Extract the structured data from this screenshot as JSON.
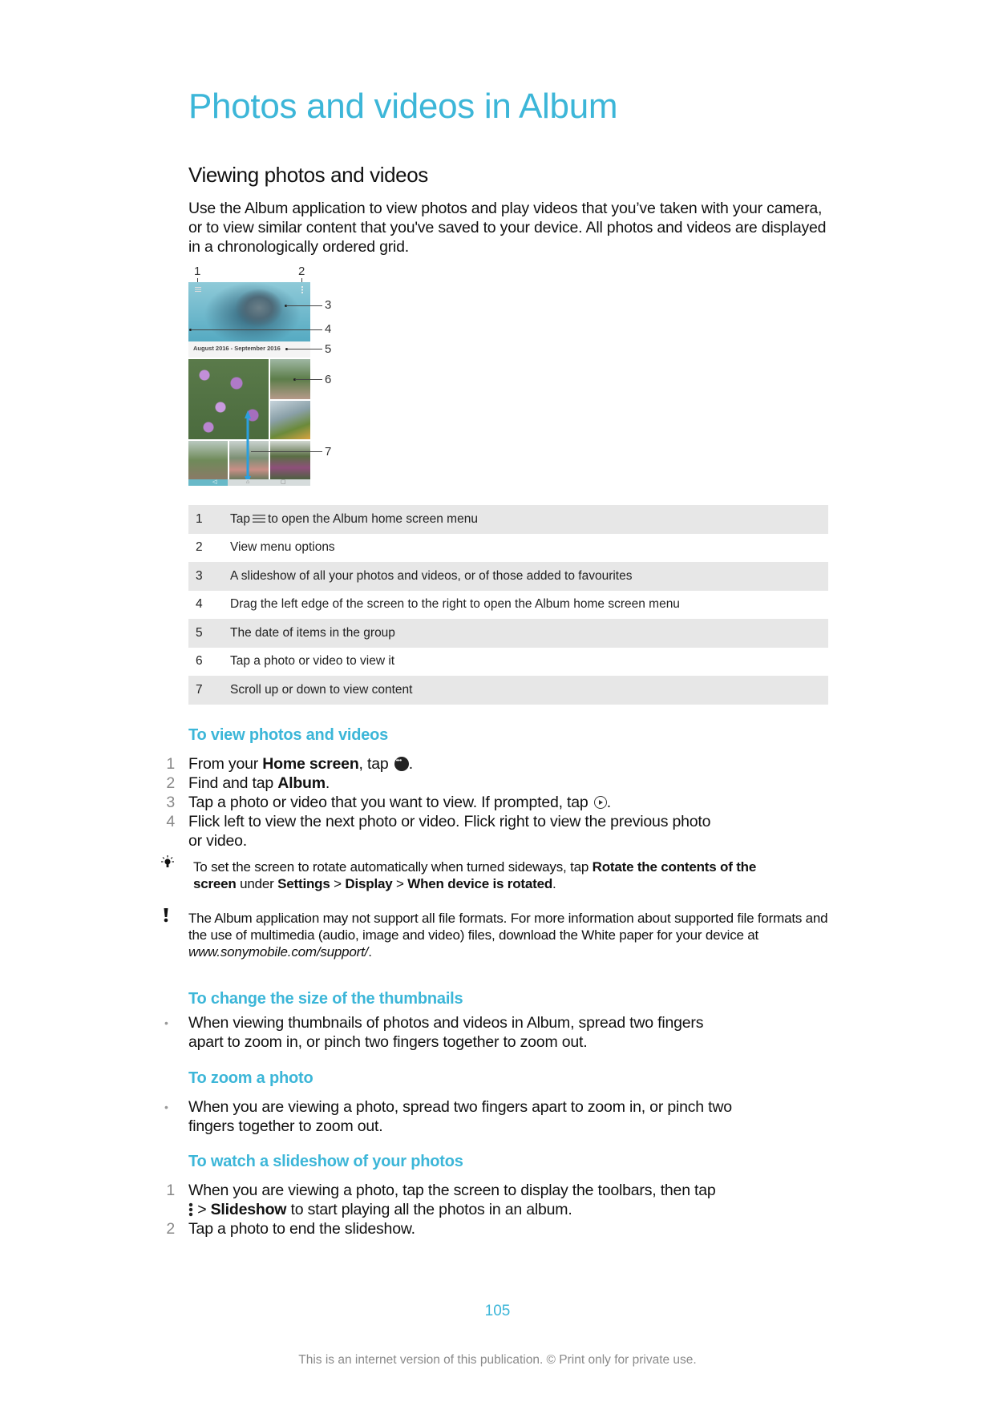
{
  "page": {
    "title": "Photos and videos in Album",
    "section_title": "Viewing photos and videos",
    "intro": "Use the Album application to view photos and play videos that you’ve taken with your camera, or to view similar content that you've saved to your device. All photos and videos are displayed in a chronologically ordered grid."
  },
  "figure": {
    "callouts": [
      "1",
      "2",
      "3",
      "4",
      "5",
      "6",
      "7"
    ],
    "date_label": "August 2016 - September 2016"
  },
  "legend": [
    {
      "num": "1",
      "before": "Tap",
      "icon": "menu-icon",
      "after": "to open the Album home screen menu"
    },
    {
      "num": "2",
      "text": "View menu options"
    },
    {
      "num": "3",
      "text": "A slideshow of all your photos and videos, or of those added to favourites"
    },
    {
      "num": "4",
      "text": "Drag the left edge of the screen to the right to open the Album home screen menu"
    },
    {
      "num": "5",
      "text": "The date of items in the group"
    },
    {
      "num": "6",
      "text": "Tap a photo or video to view it"
    },
    {
      "num": "7",
      "text": "Scroll up or down to view content"
    }
  ],
  "view_photos": {
    "heading": "To view photos and videos",
    "steps": [
      {
        "num": "1",
        "t1": "From your ",
        "b1": "Home screen",
        "t2": ", tap ",
        "icon": "apps-icon",
        "t3": "."
      },
      {
        "num": "2",
        "t1": "Find and tap ",
        "b1": "Album",
        "t2": "."
      },
      {
        "num": "3",
        "t1": "Tap a photo or video that you want to view. If prompted, tap ",
        "icon": "play-icon",
        "t2": "."
      },
      {
        "num": "4",
        "t1": "Flick left to view the next photo or video. Flick right to view the previous photo",
        "t2": "or video."
      }
    ]
  },
  "tip": {
    "icon": "lightbulb-icon",
    "t1": "To set the screen to rotate automatically when turned sideways, tap ",
    "b1": "Rotate the contents of the",
    "b2": "screen",
    "t2": " under ",
    "b3": "Settings",
    "t3": " > ",
    "b4": "Display",
    "t4": " > ",
    "b5": "When device is rotated",
    "t5": "."
  },
  "warning": {
    "icon": "exclamation-icon",
    "text": "The Album application may not support all file formats. For more information about supported file formats and the use of multimedia (audio, image and video) files, download the White paper for your device at ",
    "link": "www.sonymobile.com/support/",
    "end": "."
  },
  "thumbnails": {
    "heading": "To change the size of the thumbnails",
    "bullet": "•",
    "line1": "When viewing thumbnails of photos and videos in Album, spread two fingers",
    "line2": "apart to zoom in, or pinch two fingers together to zoom out."
  },
  "zoom_photo": {
    "heading": "To zoom a photo",
    "bullet": "•",
    "line1": "When you are viewing a photo, spread two fingers apart to zoom in, or pinch two",
    "line2": "fingers together to zoom out."
  },
  "slideshow": {
    "heading": "To watch a slideshow of your photos",
    "steps": [
      {
        "num": "1",
        "t1": "When you are viewing a photo, tap the screen to display the toolbars, then tap",
        "icon": "more-options-icon",
        "t2": " > ",
        "b1": "Slideshow",
        "t3": " to start playing all the photos in an album."
      },
      {
        "num": "2",
        "t1": "Tap a photo to end the slideshow."
      }
    ]
  },
  "footer": {
    "page_number": "105",
    "notice": "This is an internet version of this publication. © Print only for private use."
  },
  "colors": {
    "accent": "#3cb6d8",
    "table_shade": "#e7e7e7",
    "step_number": "#888888",
    "footer_text": "#8a8a8a"
  }
}
